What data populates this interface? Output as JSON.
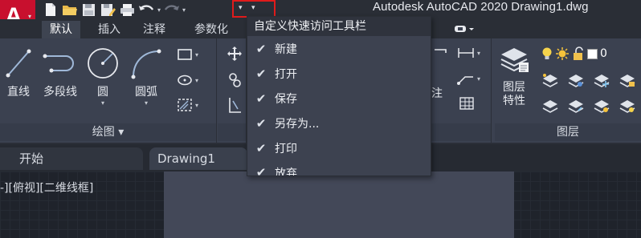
{
  "window": {
    "title": "Autodesk AutoCAD 2020    Drawing1.dwg",
    "app_button_letter": "A"
  },
  "quick_access": {
    "icons": [
      "new-icon",
      "open-icon",
      "save-icon",
      "save-as-icon",
      "print-icon",
      "undo-icon",
      "redo-icon"
    ],
    "customize_highlight_color": "#e01b1b"
  },
  "ribbon_tabs": [
    {
      "label": "默认",
      "active": true
    },
    {
      "label": "插入",
      "active": false
    },
    {
      "label": "注释",
      "active": false
    },
    {
      "label": "参数化",
      "active": false
    }
  ],
  "draw_panel": {
    "title": "绘图 ▾",
    "tools": [
      {
        "label": "直线",
        "icon": "line-icon"
      },
      {
        "label": "多段线",
        "icon": "polyline-icon"
      },
      {
        "label": "圆",
        "icon": "circle-icon"
      },
      {
        "label": "圆弧",
        "icon": "arc-icon"
      }
    ],
    "small_tools": [
      "rectangle-icon",
      "ellipse-icon",
      "hatch-icon"
    ]
  },
  "annotation_panel": {
    "partial_label": "注"
  },
  "layer_panel": {
    "title": "图层",
    "tool_label_line1": "图层",
    "tool_label_line2": "特性",
    "layer_value": "0"
  },
  "dropdown": {
    "header": "自定义快速访问工具栏",
    "items": [
      {
        "label": "新建",
        "checked": true
      },
      {
        "label": "打开",
        "checked": true
      },
      {
        "label": "保存",
        "checked": true
      },
      {
        "label": "另存为...",
        "checked": true
      },
      {
        "label": "打印",
        "checked": true
      },
      {
        "label": "放弃",
        "checked": true
      }
    ]
  },
  "document_tabs": [
    {
      "label": "开始"
    },
    {
      "label": "Drawing1"
    }
  ],
  "viewport": {
    "label": "-][俯视][二维线框]"
  },
  "colors": {
    "brand_red": "#c8102e",
    "ribbon_bg": "#3b4150",
    "titlebar_bg": "#2a2e36",
    "menu_bg": "#3d4250"
  }
}
